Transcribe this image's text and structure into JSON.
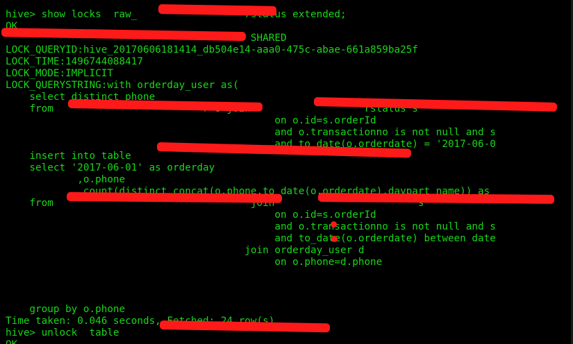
{
  "colors": {
    "background": "#000000",
    "text": "#19d619",
    "redaction": "#ff1a1a"
  },
  "terminal": {
    "lines": [
      "",
      "hive> show locks  raw_                  rstatus extended;",
      "OK",
      "                                         SHARED",
      "LOCK_QUERYID:hive_20170606181414_db504e14-aaa0-475c-abae-661a859ba25f",
      "LOCK_TIME:1496744088417",
      "LOCK_MODE:IMPLICIT",
      "LOCK_QUERYSTRING:with orderday_user as(",
      "    select distinct phone",
      "    from                         r o join                   rstatus s",
      "                                             on o.id=s.orderId",
      "                                             and o.transactionno is not null and s",
      "                                             and to_date(o.orderdate) = '2017-06-0",
      "    insert into table",
      "    select '2017-06-01' as orderday",
      "            ,o.phone",
      "            ,count(distinct concat(o.phone,to_date(o.orderdate),daypart_name)) as",
      "    from                                 join                        s",
      "                                             on o.id=s.orderId",
      "                                             and o.transactionno is not null and s",
      "                                             and to_date(o.orderdate) between date",
      "                                        join orderday_user d",
      "                                             on o.phone=d.phone",
      "",
      "",
      "",
      "    group by o.phone",
      "Time taken: 0.046 seconds, Fetched: 24 row(s)",
      "hive> unlock  table",
      "OK"
    ]
  }
}
